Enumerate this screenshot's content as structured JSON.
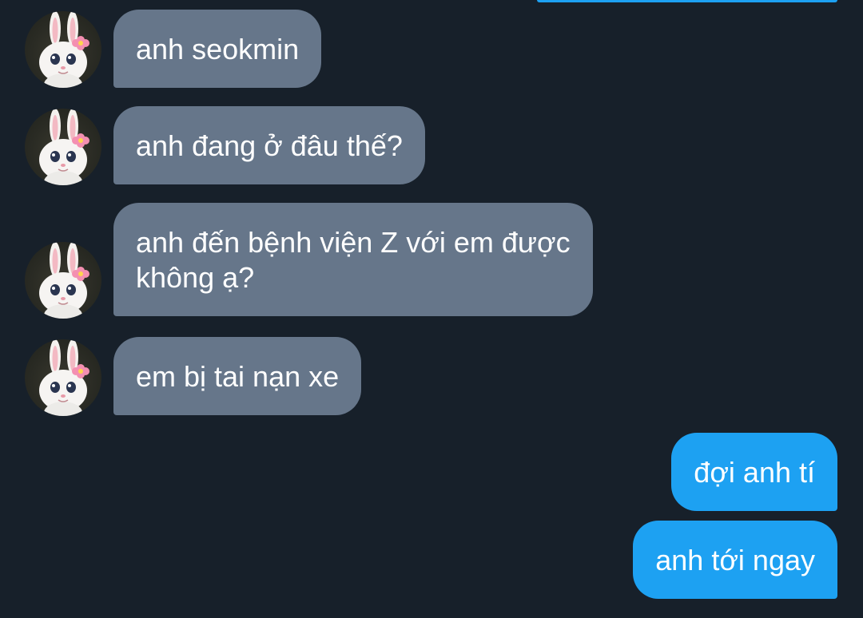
{
  "conversation": {
    "incoming": [
      {
        "text": "anh seokmin",
        "avatar_icon": "bunny-avatar-icon"
      },
      {
        "text": "anh đang ở đâu thế?",
        "avatar_icon": "bunny-avatar-icon"
      },
      {
        "text": "anh đến bệnh viện Z với em được\nkhông ạ?",
        "avatar_icon": "bunny-avatar-icon"
      },
      {
        "text": "em bị tai nạn xe",
        "avatar_icon": "bunny-avatar-icon"
      }
    ],
    "outgoing": [
      {
        "text": "đợi anh tí"
      },
      {
        "text": "anh tới ngay"
      }
    ]
  },
  "colors": {
    "background": "#17202a",
    "incoming_bubble": "#66768a",
    "outgoing_bubble": "#1da1f2",
    "text": "#ffffff"
  }
}
